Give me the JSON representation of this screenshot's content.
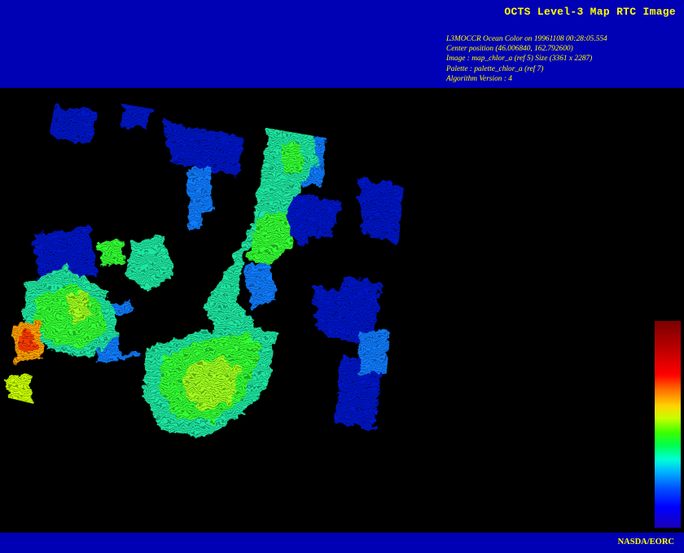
{
  "header": {
    "title": "OCTS Level-3 Map RTC Image",
    "meta_lines": [
      "L3MOCCR Ocean Color on 19961108 00:28:05.554",
      "Center position (46.006840, 162.792600)",
      "Image : map_chlor_a (ref 5) Size (3361 x 2287)",
      "Palette : palette_chlor_a (ref 7)",
      "Algorithm Version : 4"
    ]
  },
  "footer": {
    "credit": "NASDA/EORC"
  },
  "colors": {
    "banner": "#0000b4",
    "text": "#ffff00",
    "background": "#000000"
  },
  "colorbar": {
    "palette": "chlorophyll-a rainbow (low=blue, high=dark red)"
  }
}
